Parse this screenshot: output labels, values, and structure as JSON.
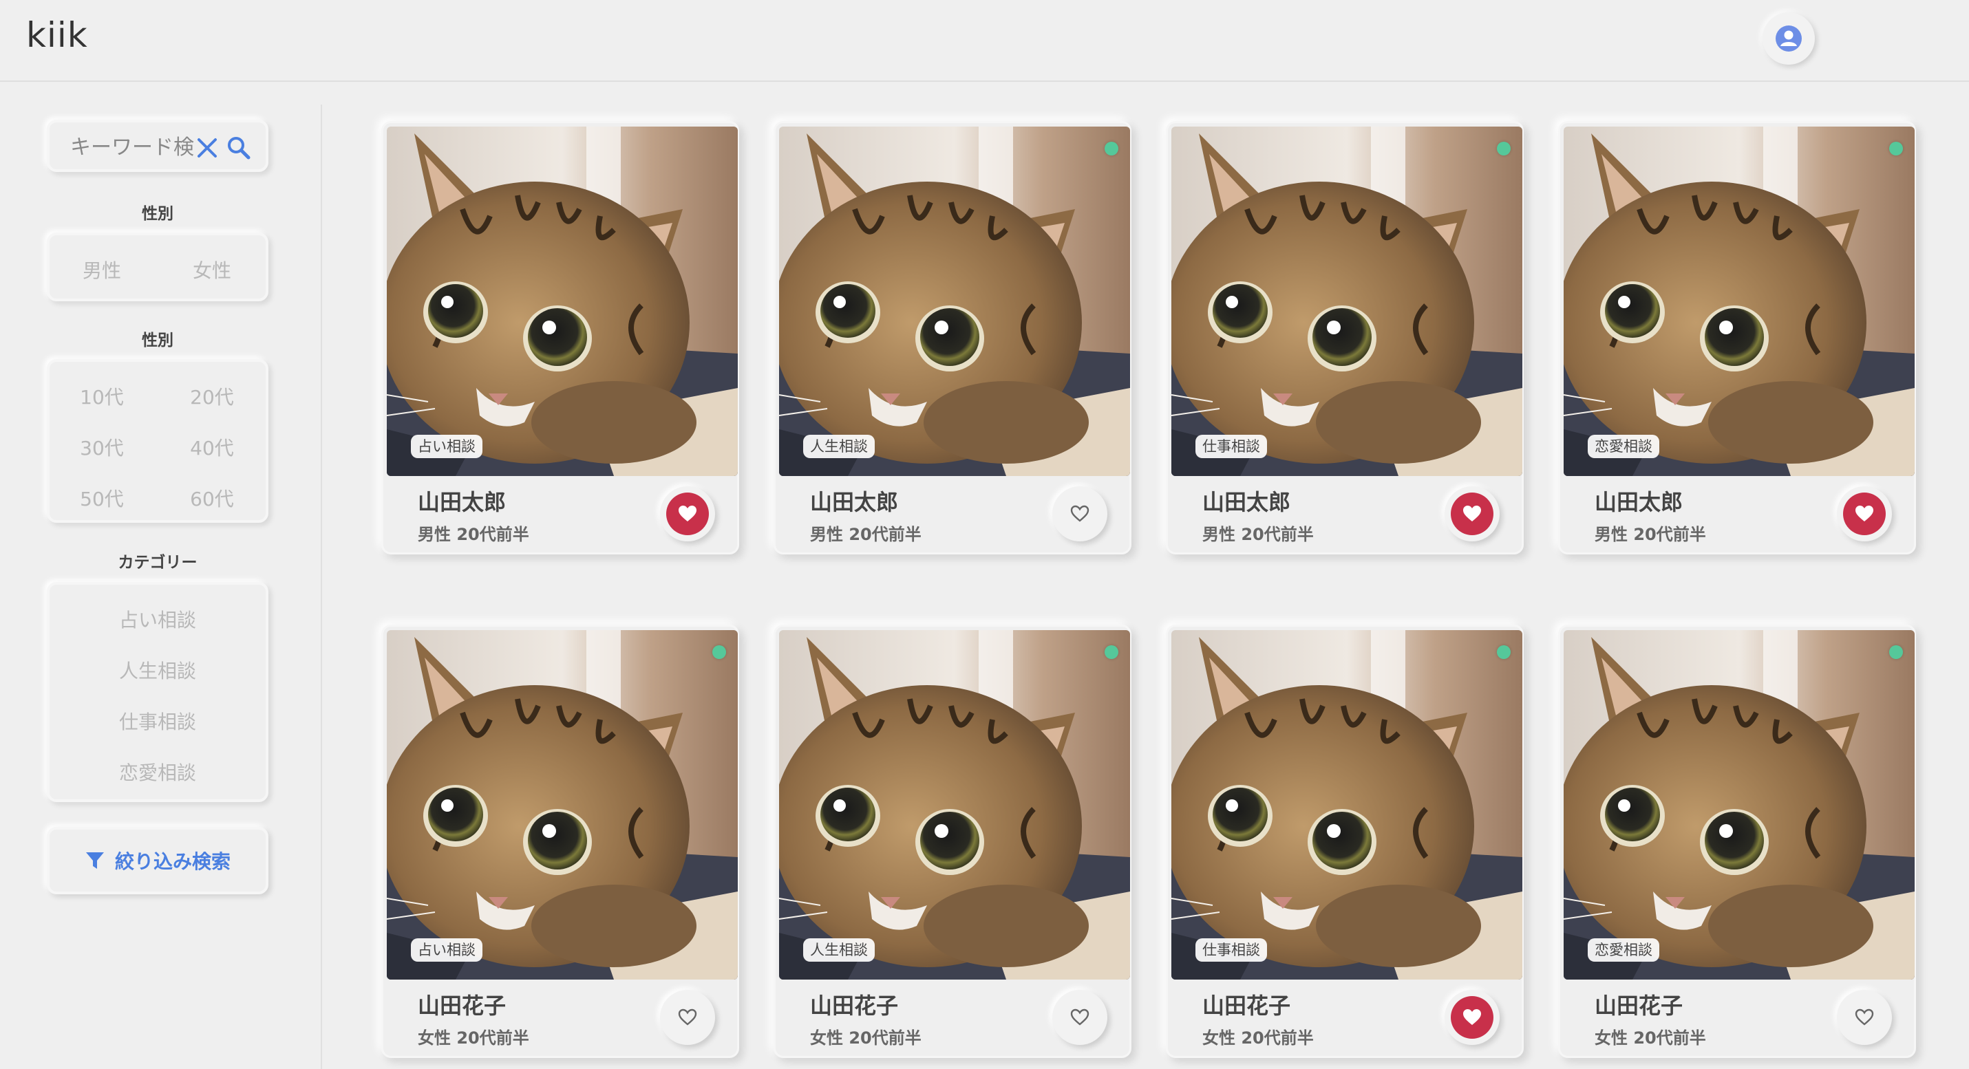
{
  "app": {
    "logo": "kiik"
  },
  "search": {
    "placeholder": "キーワード検索"
  },
  "filters": {
    "gender": {
      "label": "性別",
      "options": [
        "男性",
        "女性"
      ]
    },
    "age": {
      "label": "性別",
      "options": [
        "10代",
        "20代",
        "30代",
        "40代",
        "50代",
        "60代"
      ]
    },
    "category": {
      "label": "カテゴリー",
      "options": [
        "占い相談",
        "人生相談",
        "仕事相談",
        "恋愛相談"
      ]
    },
    "submit_label": "絞り込み検索"
  },
  "colors": {
    "accent": "#4a7fe0",
    "favorite": "#c8304a",
    "online": "#55c89a"
  },
  "cards": [
    {
      "name": "山田太郎",
      "meta": "男性 20代前半",
      "category": "占い相談",
      "favorited": true,
      "online": false
    },
    {
      "name": "山田太郎",
      "meta": "男性 20代前半",
      "category": "人生相談",
      "favorited": false,
      "online": true
    },
    {
      "name": "山田太郎",
      "meta": "男性 20代前半",
      "category": "仕事相談",
      "favorited": true,
      "online": true
    },
    {
      "name": "山田太郎",
      "meta": "男性 20代前半",
      "category": "恋愛相談",
      "favorited": true,
      "online": true
    },
    {
      "name": "山田花子",
      "meta": "女性 20代前半",
      "category": "占い相談",
      "favorited": false,
      "online": true
    },
    {
      "name": "山田花子",
      "meta": "女性 20代前半",
      "category": "人生相談",
      "favorited": false,
      "online": true
    },
    {
      "name": "山田花子",
      "meta": "女性 20代前半",
      "category": "仕事相談",
      "favorited": true,
      "online": true
    },
    {
      "name": "山田花子",
      "meta": "女性 20代前半",
      "category": "恋愛相談",
      "favorited": false,
      "online": true
    }
  ]
}
